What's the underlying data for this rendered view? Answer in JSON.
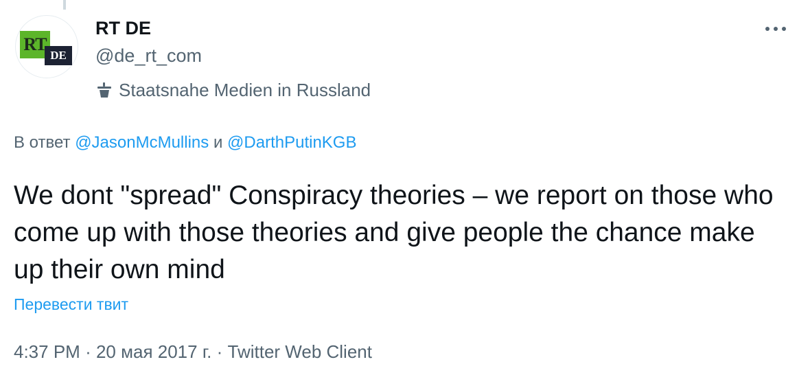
{
  "author": {
    "display_name": "RT DE",
    "handle": "@de_rt_com",
    "avatar_logo": {
      "left_text": "RT",
      "right_text": "DE",
      "left_color": "#5cb52a",
      "right_color": "#1c2233"
    },
    "label_icon": "podium-icon",
    "label": "Staatsnahe Medien in Russland"
  },
  "reply": {
    "prefix": "В ответ",
    "mention_1": "@JasonMcMullins",
    "conjunction": "и",
    "mention_2": "@DarthPutinKGB"
  },
  "tweet": {
    "text": "We dont \"spread\" Conspiracy theories – we report on those who come up with those theories and give people the chance make up their own mind",
    "translate_label": "Перевести твит"
  },
  "meta": {
    "time": "4:37 PM",
    "separator": "·",
    "date": "20 мая 2017 г.",
    "source": "Twitter Web Client"
  },
  "colors": {
    "accent": "#1d9bf0",
    "secondary_text": "#536471",
    "primary_text": "#0f1419"
  }
}
